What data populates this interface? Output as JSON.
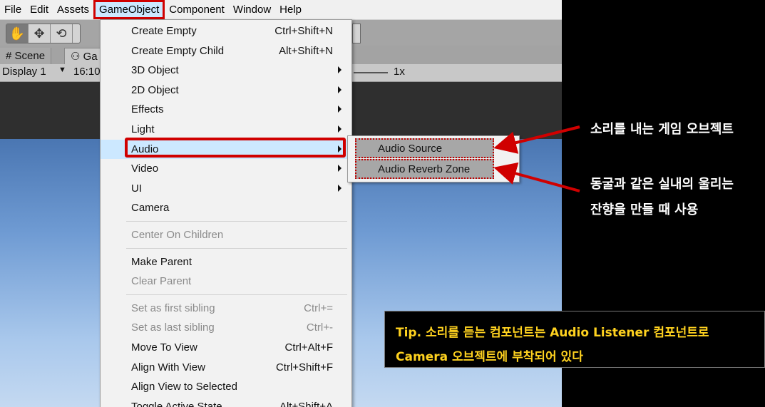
{
  "menubar": {
    "items": [
      "File",
      "Edit",
      "Assets",
      "GameObject",
      "Component",
      "Window",
      "Help"
    ],
    "active_index": 3
  },
  "tabs": {
    "scene": "Scene",
    "game": "Ga"
  },
  "game_toolbar": {
    "display": "Display 1",
    "resolution": "16:10",
    "zoom": "1x"
  },
  "gameobject_menu": {
    "items": [
      {
        "label": "Create Empty",
        "shortcut": "Ctrl+Shift+N",
        "submenu": false,
        "disabled": false
      },
      {
        "label": "Create Empty Child",
        "shortcut": "Alt+Shift+N",
        "submenu": false,
        "disabled": false
      },
      {
        "label": "3D Object",
        "shortcut": "",
        "submenu": true,
        "disabled": false
      },
      {
        "label": "2D Object",
        "shortcut": "",
        "submenu": true,
        "disabled": false
      },
      {
        "label": "Effects",
        "shortcut": "",
        "submenu": true,
        "disabled": false
      },
      {
        "label": "Light",
        "shortcut": "",
        "submenu": true,
        "disabled": false
      },
      {
        "label": "Audio",
        "shortcut": "",
        "submenu": true,
        "disabled": false,
        "highlighted": true
      },
      {
        "label": "Video",
        "shortcut": "",
        "submenu": true,
        "disabled": false
      },
      {
        "label": "UI",
        "shortcut": "",
        "submenu": true,
        "disabled": false
      },
      {
        "label": "Camera",
        "shortcut": "",
        "submenu": false,
        "disabled": false
      },
      {
        "label": "Center On Children",
        "shortcut": "",
        "submenu": false,
        "disabled": true
      },
      {
        "label": "Make Parent",
        "shortcut": "",
        "submenu": false,
        "disabled": false
      },
      {
        "label": "Clear Parent",
        "shortcut": "",
        "submenu": false,
        "disabled": true
      },
      {
        "label": "Set as first sibling",
        "shortcut": "Ctrl+=",
        "submenu": false,
        "disabled": true
      },
      {
        "label": "Set as last sibling",
        "shortcut": "Ctrl+-",
        "submenu": false,
        "disabled": true
      },
      {
        "label": "Move To View",
        "shortcut": "Ctrl+Alt+F",
        "submenu": false,
        "disabled": false
      },
      {
        "label": "Align With View",
        "shortcut": "Ctrl+Shift+F",
        "submenu": false,
        "disabled": false
      },
      {
        "label": "Align View to Selected",
        "shortcut": "",
        "submenu": false,
        "disabled": false
      },
      {
        "label": "Toggle Active State",
        "shortcut": "Alt+Shift+A",
        "submenu": false,
        "disabled": false
      }
    ]
  },
  "audio_submenu": {
    "items": [
      "Audio Source",
      "Audio Reverb Zone"
    ]
  },
  "annotations": {
    "audio_source_note": "소리를 내는 게임 오브젝트",
    "reverb_note_line1": "동굴과 같은 실내의 울리는",
    "reverb_note_line2": "잔향을 만들 때 사용",
    "tip_line1": "Tip. 소리를 듣는 컴포넌트는 Audio Listener 컴포넌트로",
    "tip_line2": "Camera 오브젝트에 부착되어 있다"
  },
  "colors": {
    "highlight_red": "#d00000",
    "tip_yellow": "#ffd21f",
    "menu_highlight": "#cce8ff"
  }
}
